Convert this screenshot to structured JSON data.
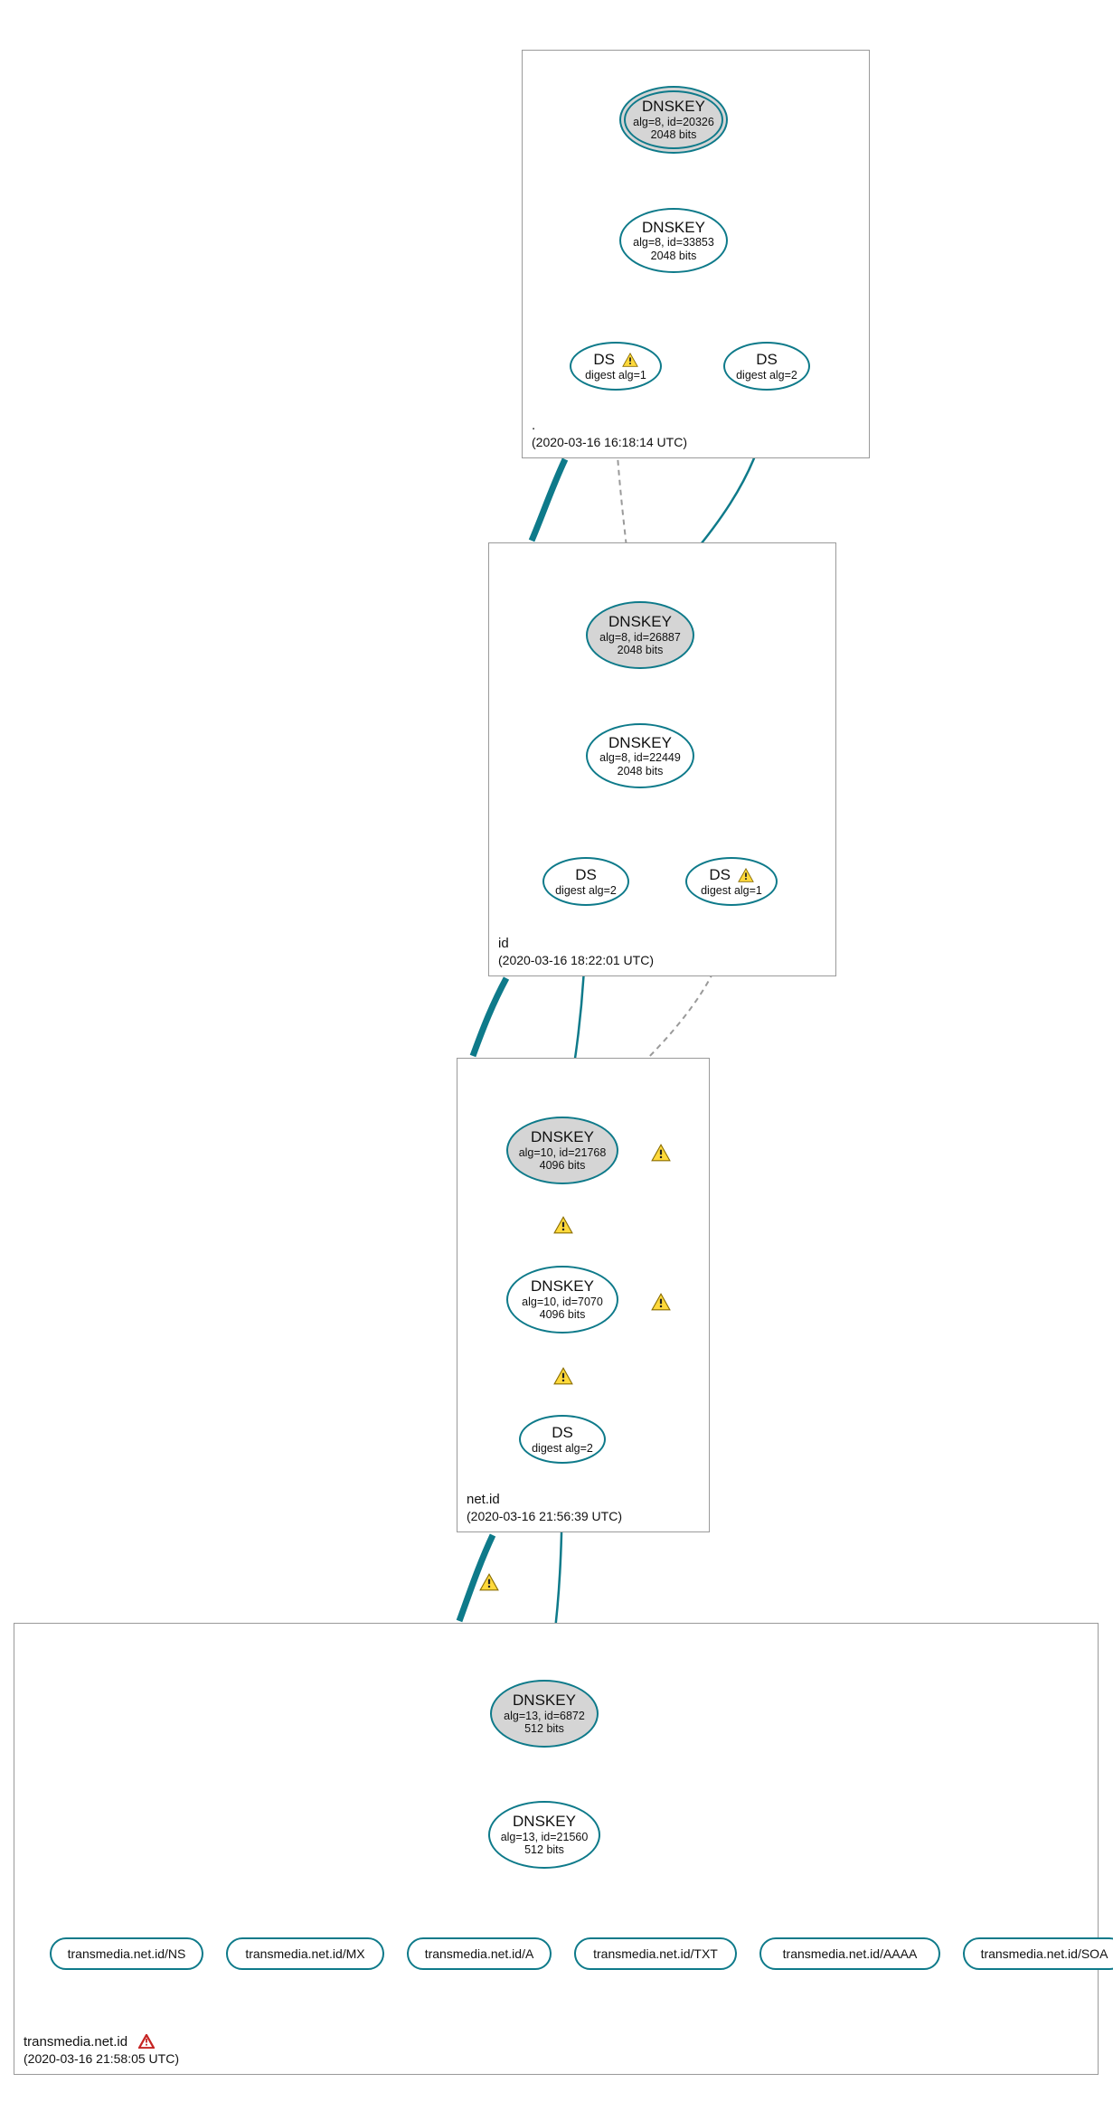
{
  "colors": {
    "teal": "#0e7a8a",
    "grey": "#9a9a9a"
  },
  "zones": {
    "root": {
      "name": ".",
      "timestamp": "(2020-03-16 16:18:14 UTC)"
    },
    "id": {
      "name": "id",
      "timestamp": "(2020-03-16 18:22:01 UTC)"
    },
    "netid": {
      "name": "net.id",
      "timestamp": "(2020-03-16 21:56:39 UTC)"
    },
    "transmedia": {
      "name": "transmedia.net.id",
      "timestamp": "(2020-03-16 21:58:05 UTC)"
    }
  },
  "nodes": {
    "root_ksk": {
      "title": "DNSKEY",
      "line1": "alg=8, id=20326",
      "line2": "2048 bits"
    },
    "root_zsk": {
      "title": "DNSKEY",
      "line1": "alg=8, id=33853",
      "line2": "2048 bits"
    },
    "root_ds1": {
      "title": "DS",
      "line1": "digest alg=1"
    },
    "root_ds2": {
      "title": "DS",
      "line1": "digest alg=2"
    },
    "id_ksk": {
      "title": "DNSKEY",
      "line1": "alg=8, id=26887",
      "line2": "2048 bits"
    },
    "id_zsk": {
      "title": "DNSKEY",
      "line1": "alg=8, id=22449",
      "line2": "2048 bits"
    },
    "id_ds2": {
      "title": "DS",
      "line1": "digest alg=2"
    },
    "id_ds1": {
      "title": "DS",
      "line1": "digest alg=1"
    },
    "netid_ksk": {
      "title": "DNSKEY",
      "line1": "alg=10, id=21768",
      "line2": "4096 bits"
    },
    "netid_zsk": {
      "title": "DNSKEY",
      "line1": "alg=10, id=7070",
      "line2": "4096 bits"
    },
    "netid_ds": {
      "title": "DS",
      "line1": "digest alg=2"
    },
    "trans_ksk": {
      "title": "DNSKEY",
      "line1": "alg=13, id=6872",
      "line2": "512 bits"
    },
    "trans_zsk": {
      "title": "DNSKEY",
      "line1": "alg=13, id=21560",
      "line2": "512 bits"
    }
  },
  "records": {
    "ns": "transmedia.net.id/NS",
    "mx": "transmedia.net.id/MX",
    "a": "transmedia.net.id/A",
    "txt": "transmedia.net.id/TXT",
    "aaaa": "transmedia.net.id/AAAA",
    "soa": "transmedia.net.id/SOA"
  }
}
